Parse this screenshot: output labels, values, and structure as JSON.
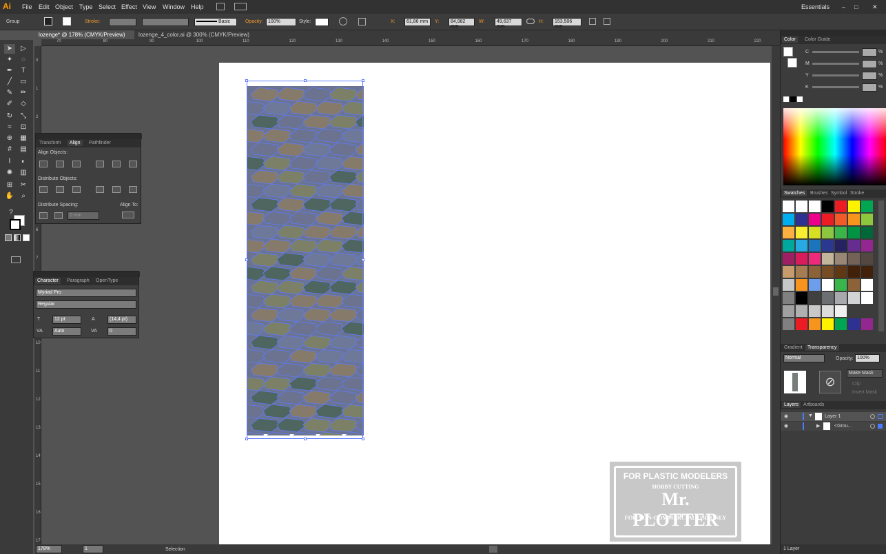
{
  "app": {
    "logo": "Ai"
  },
  "menu": [
    "File",
    "Edit",
    "Object",
    "Type",
    "Select",
    "Effect",
    "View",
    "Window",
    "Help"
  ],
  "workspace": "Essentials",
  "control_bar": {
    "selection": "Group",
    "stroke_label": "Stroke:",
    "brush": "Basic",
    "opacity_label": "Opacity:",
    "opacity": "100%",
    "style_label": "Style:",
    "x_label": "X:",
    "x": "61,86 mm",
    "y_label": "Y:",
    "y": "84,982 mm",
    "w_label": "W:",
    "w": "49,637 mm",
    "h_label": "H:",
    "h": "153,506 mm"
  },
  "doc_tabs": [
    {
      "label": "lozenge* @ 178% (CMYK/Preview)",
      "close": "×"
    },
    {
      "label": "lozenge_4_color.ai @ 300% (CMYK/Preview)",
      "close": "×"
    }
  ],
  "ruler_top": [
    "70",
    "80",
    "90",
    "100",
    "110",
    "120",
    "130",
    "140",
    "150",
    "160",
    "170",
    "180",
    "190",
    "200",
    "210",
    "220",
    "230"
  ],
  "ruler_left": [
    "0",
    "1",
    "2",
    "3",
    "4",
    "5",
    "6",
    "7",
    "8",
    "9",
    "10",
    "11",
    "12",
    "13",
    "14",
    "15",
    "16",
    "17"
  ],
  "align_panel": {
    "tabs": [
      "Transform",
      "Align",
      "Pathfinder"
    ],
    "align_objects": "Align Objects:",
    "distribute_objects": "Distribute Objects:",
    "distribute_spacing": "Distribute Spacing:",
    "align_to": "Align To:",
    "spacing_value": "0 mm"
  },
  "character_panel": {
    "tabs": [
      "Character",
      "Paragraph",
      "OpenType"
    ],
    "font": "Myriad Pro",
    "style": "Regular",
    "size": "12 pt",
    "leading": "(14,4 pt)",
    "kerning": "Auto",
    "tracking": "0"
  },
  "color_panel": {
    "tabs": [
      "Color",
      "Color Guide"
    ],
    "channels": [
      "C",
      "M",
      "Y",
      "K"
    ],
    "pct": "%"
  },
  "swatches_panel": {
    "tabs": [
      "Swatches",
      "Brushes",
      "Symbol",
      "Stroke"
    ],
    "colors": [
      [
        "#ffffff",
        "#ffffff",
        "#ffffff",
        "#000000",
        "#ed1c24",
        "#fff200",
        "#00a651"
      ],
      [
        "#00aeef",
        "#2e3192",
        "#ec008c",
        "#ed1c24",
        "#f15a29",
        "#f7941d",
        "#8dc63f"
      ],
      [
        "#fbb040",
        "#f9ed32",
        "#d7df23",
        "#8dc63f",
        "#39b54a",
        "#009444",
        "#006838"
      ],
      [
        "#00a79d",
        "#27aae1",
        "#1c75bc",
        "#2b388f",
        "#262262",
        "#662d91",
        "#92278f"
      ],
      [
        "#9e1f63",
        "#da1c5c",
        "#ee2a7b",
        "#c2b59b",
        "#998675",
        "#736357",
        "#534741"
      ],
      [
        "#c69c6d",
        "#a67c52",
        "#8c6239",
        "#754c24",
        "#603813",
        "#42210b",
        "#42210b"
      ],
      [
        "#c7c7c7",
        "#f7941d",
        "#6d9eeb",
        "#ffffff",
        "#39b54a",
        "#8c6239",
        "#ffffff"
      ],
      [
        "#808080",
        "#000000",
        "#404040",
        "#6d6e71",
        "#a7a9ac",
        "#d1d3d4",
        "#ffffff"
      ],
      [
        "#a0a0a0",
        "#b0b0b0",
        "#c8c8c8",
        "#dcdcdc",
        "#f0f0f0",
        "#3c3c3c",
        "#3c3c3c"
      ],
      [
        "#808080",
        "#ed1c24",
        "#f7941d",
        "#fff200",
        "#00a651",
        "#2e3192",
        "#92278f"
      ]
    ]
  },
  "transparency_panel": {
    "tabs": [
      "Gradient",
      "Transparency"
    ],
    "mode": "Normal",
    "opacity_label": "Opacity:",
    "opacity": "100%",
    "make_mask": "Make Mask",
    "clip": "Clip",
    "invert": "Invert Mask"
  },
  "layers_panel": {
    "tabs": [
      "Layers",
      "Artboards"
    ],
    "rows": [
      "Layer 1",
      "<Grou..."
    ],
    "count": "1 Layer"
  },
  "watermark": {
    "line1": "FOR PLASTIC MODELERS",
    "line2": "HOBBY CUTTING",
    "line3": "Mr. PLOTTER",
    "line4": "FOR NON-COMMERCIAL USE ONLY"
  },
  "status": {
    "zoom": "178%",
    "page": "1",
    "tool": "Selection"
  },
  "pattern_colors": [
    "#6b7390",
    "#7c8066",
    "#867b6b",
    "#4f6660",
    "#6e7898"
  ]
}
